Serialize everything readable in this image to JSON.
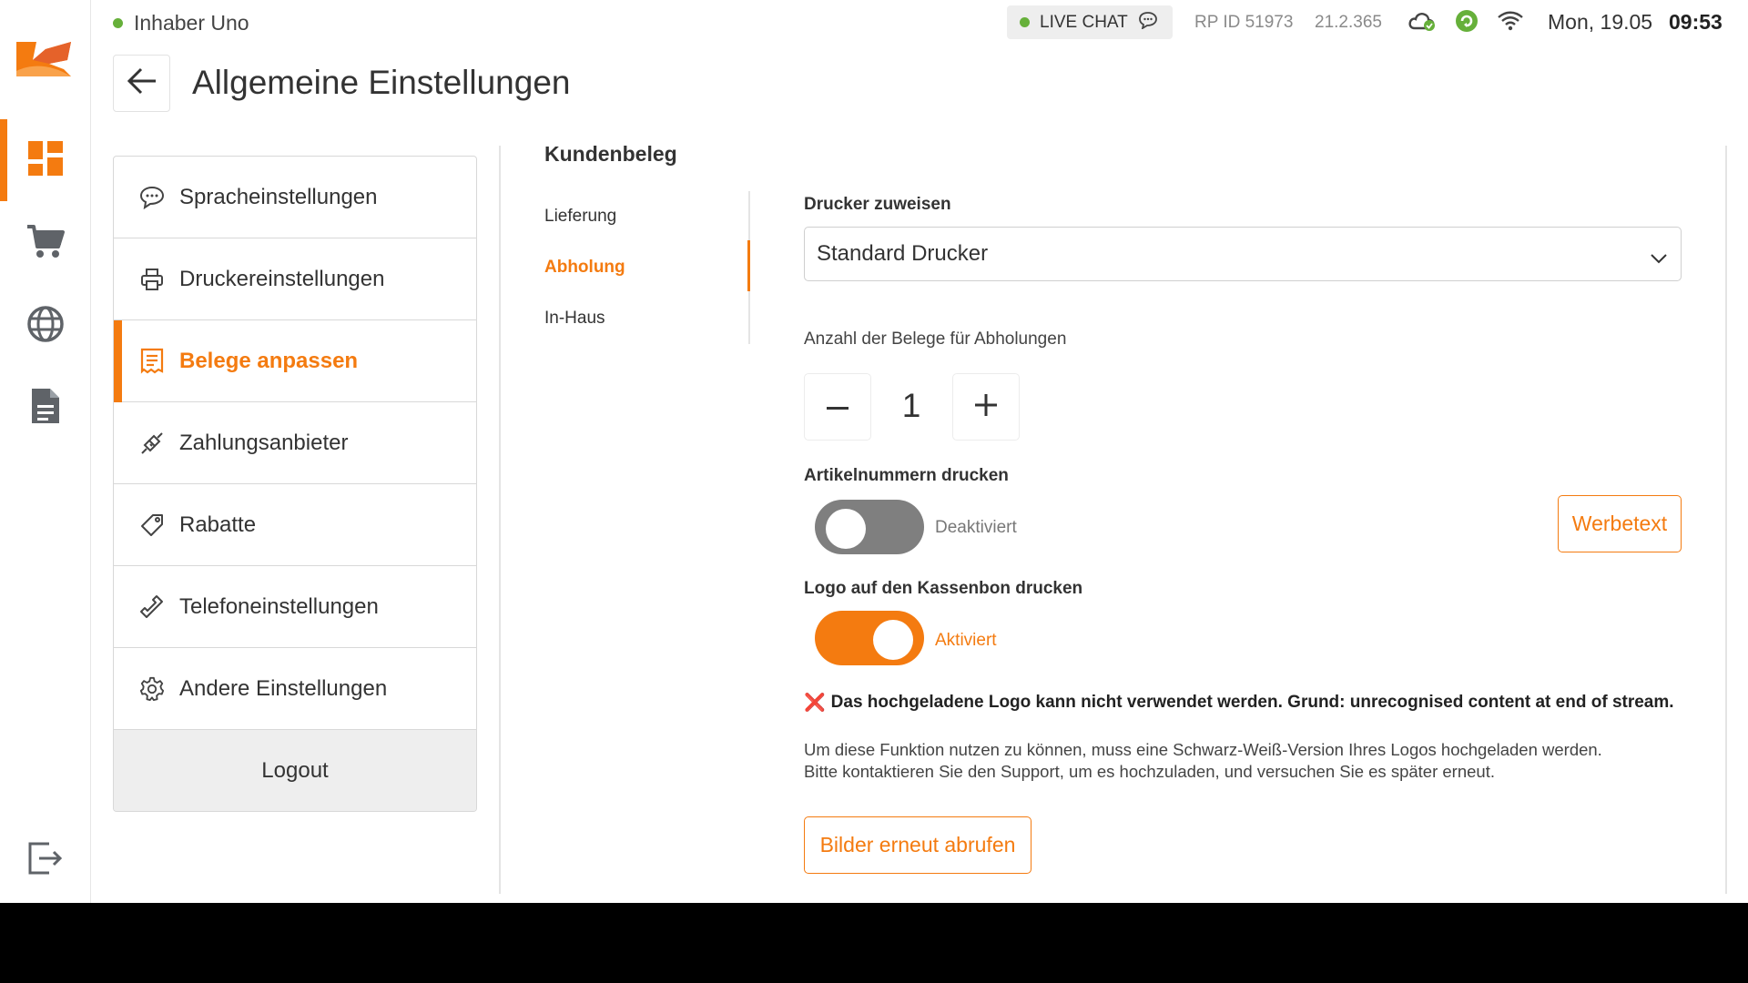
{
  "topbar": {
    "owner": "Inhaber Uno",
    "live_chat": "LIVE CHAT",
    "rp_id": "RP ID 51973",
    "version": "21.2.365",
    "date": "Mon, 19.05",
    "time": "09:53"
  },
  "rail": {
    "items": [
      "dashboard-icon",
      "cart-icon",
      "globe-icon",
      "document-icon",
      "exit-icon"
    ],
    "accent": "#f47b10"
  },
  "header": {
    "title": "Allgemeine Einstellungen"
  },
  "menu": {
    "items": [
      {
        "label": "Spracheinstellungen",
        "icon": "chat-icon"
      },
      {
        "label": "Druckereinstellungen",
        "icon": "printer-icon"
      },
      {
        "label": "Belege anpassen",
        "icon": "receipt-icon",
        "active": true
      },
      {
        "label": "Zahlungsanbieter",
        "icon": "plug-icon"
      },
      {
        "label": "Rabatte",
        "icon": "tag-icon"
      },
      {
        "label": "Telefoneinstellungen",
        "icon": "phone-icon"
      },
      {
        "label": "Andere Einstellungen",
        "icon": "gear-icon"
      }
    ],
    "logout": "Logout"
  },
  "section": {
    "title": "Kundenbeleg",
    "subnav": [
      "Lieferung",
      "Abholung",
      "In-Haus"
    ],
    "active_subnav": "Abholung"
  },
  "content": {
    "printer_label": "Drucker zuweisen",
    "printer_value": "Standard Drucker",
    "receipt_count_label": "Anzahl der Belege für Abholungen",
    "receipt_count": "1",
    "minus": "−",
    "plus": "+",
    "article_numbers_label": "Artikelnummern drucken",
    "article_numbers_state": "Deaktiviert",
    "article_numbers_enabled": false,
    "werbetext_button": "Werbetext",
    "logo_label": "Logo auf den Kassenbon drucken",
    "logo_state": "Aktiviert",
    "logo_enabled": true,
    "error_icon": "❌",
    "error_message": "Das hochgeladene Logo kann nicht verwendet werden. Grund: unrecognised content at end of stream.",
    "info_line1": "Um diese Funktion nutzen zu können, muss eine Schwarz-Weiß-Version Ihres Logos hochgeladen werden.",
    "info_line2": "Bitte kontaktieren Sie den Support, um es hochzuladen, und versuchen Sie es später erneut.",
    "refetch_button": "Bilder erneut abrufen"
  },
  "colors": {
    "accent": "#f47b10",
    "status_green": "#66b03a",
    "toggle_off": "#7f7f7f"
  }
}
